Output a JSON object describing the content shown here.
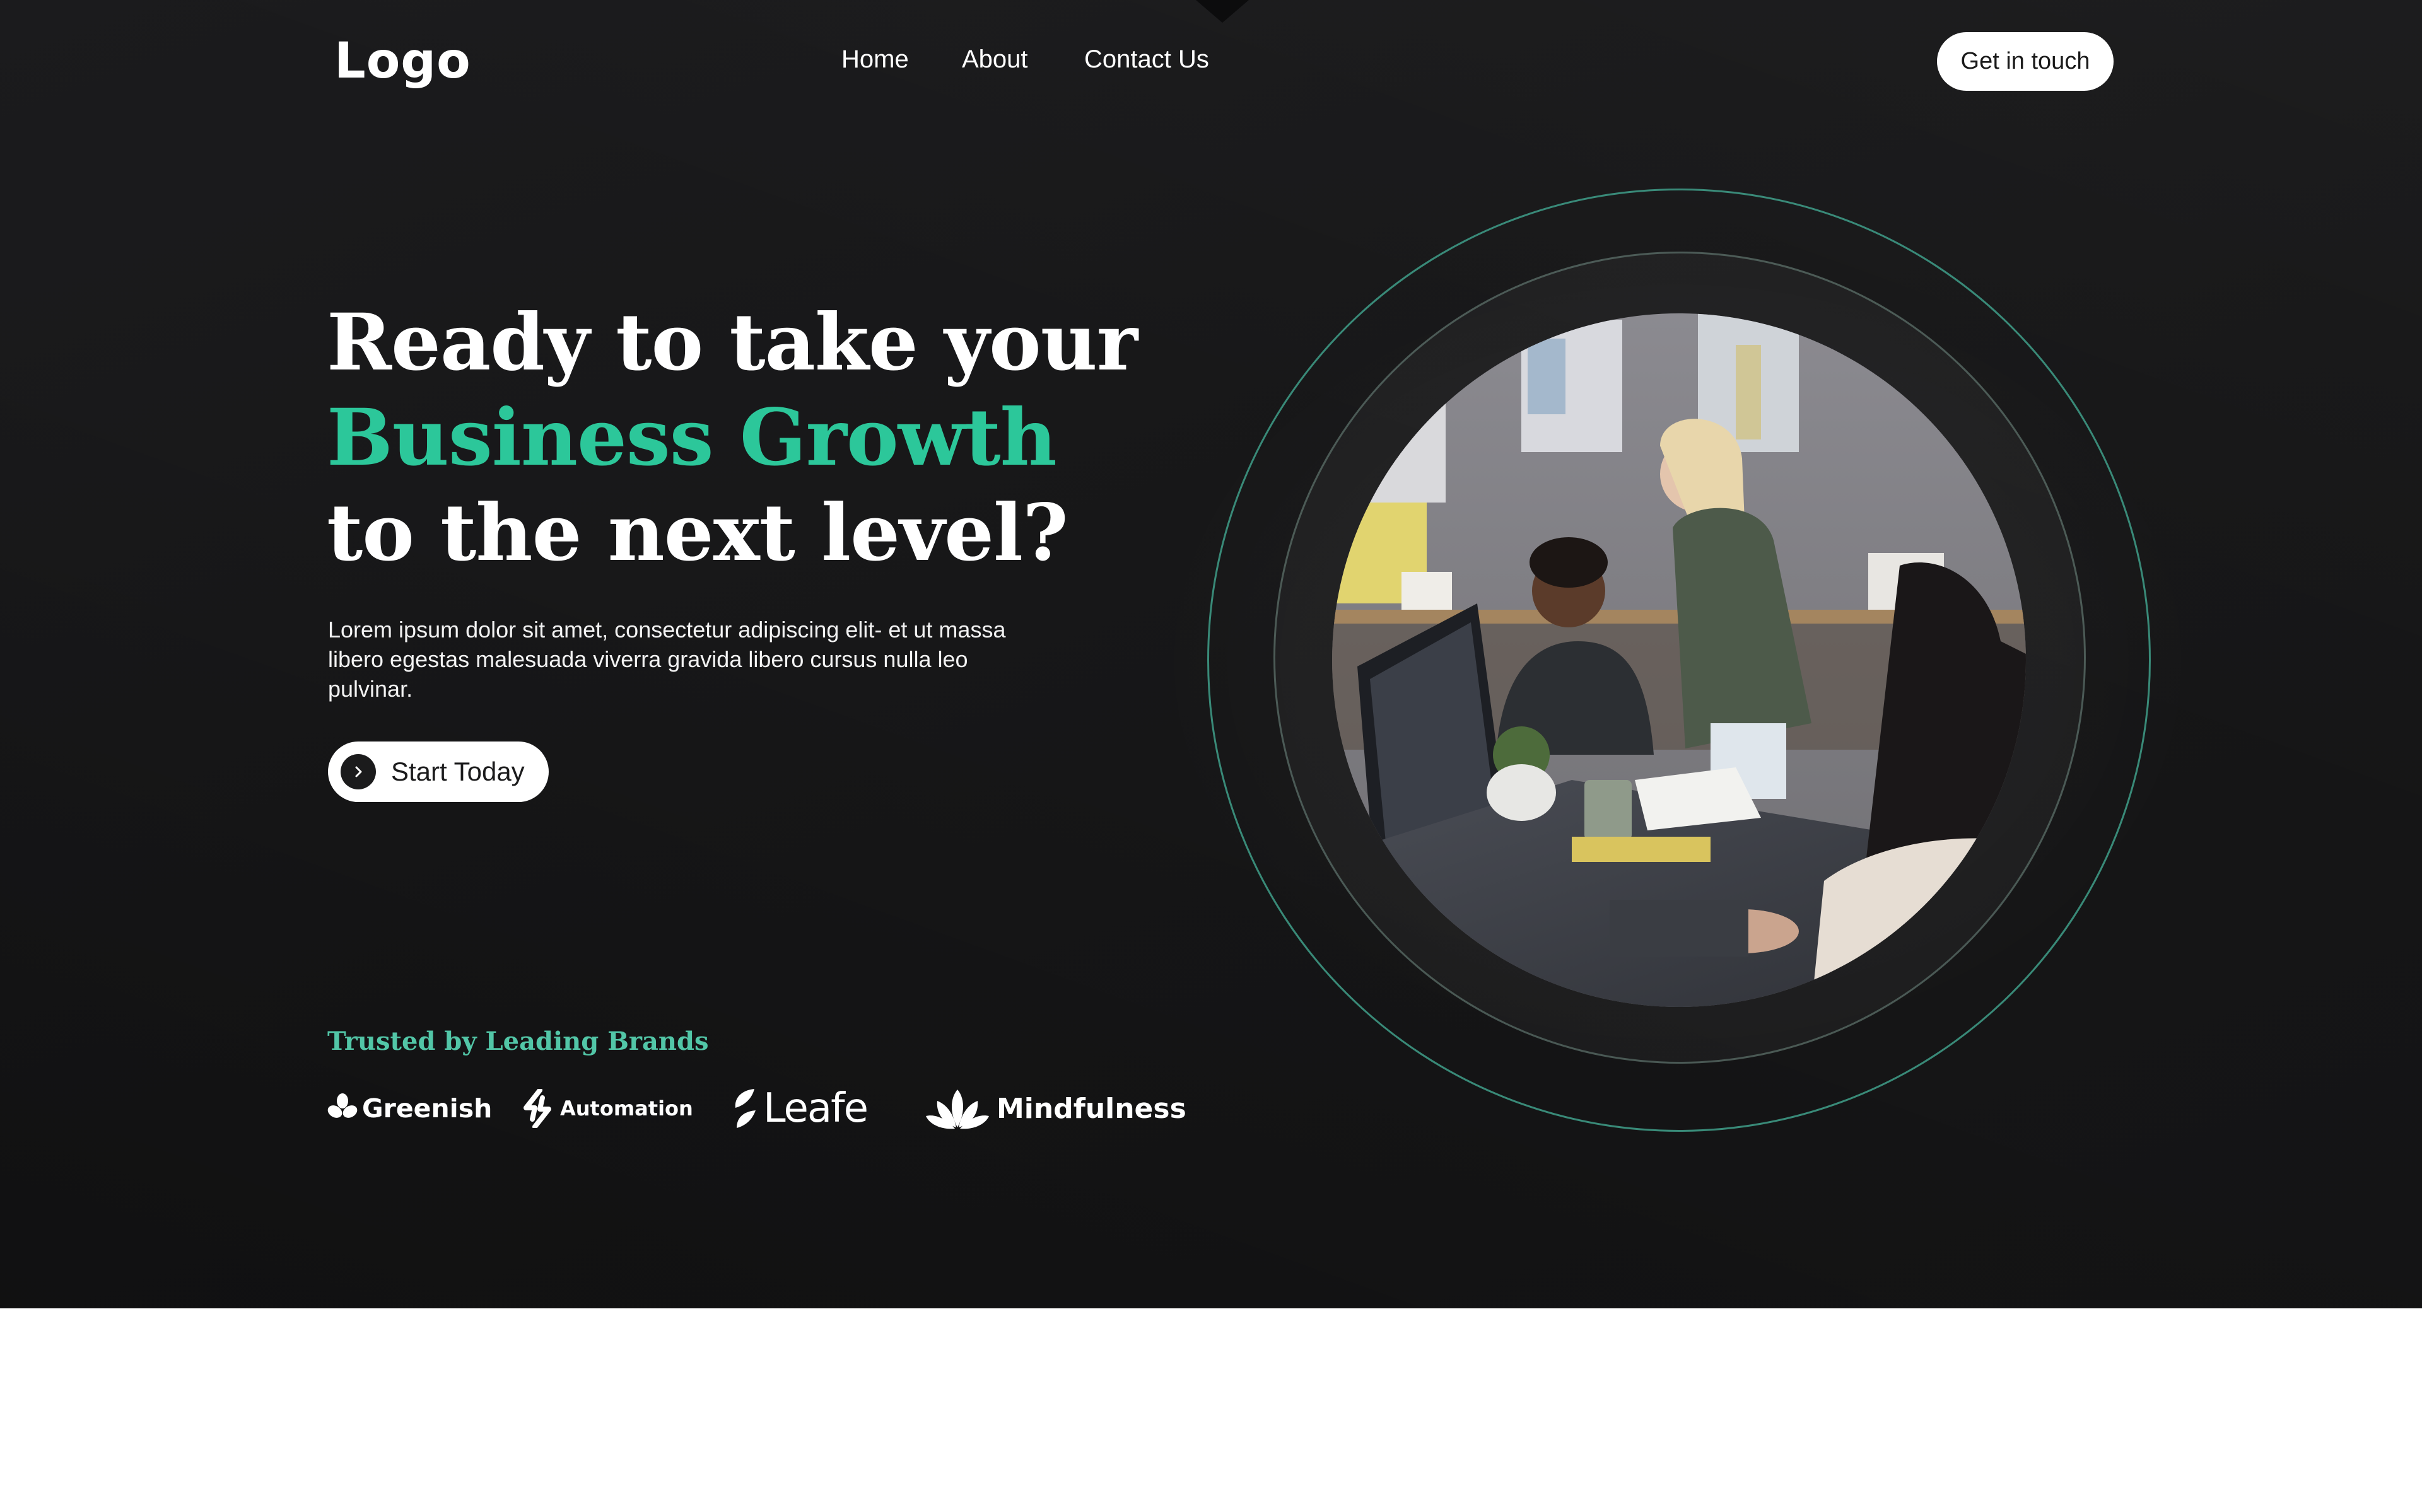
{
  "header": {
    "logo": "Logo",
    "nav": [
      {
        "label": "Home"
      },
      {
        "label": "About"
      },
      {
        "label": "Contact Us"
      }
    ],
    "cta_label": "Get in touch"
  },
  "hero": {
    "headline_line1": "Ready to take your",
    "headline_line2": "Business Growth",
    "headline_line3": "to the next level?",
    "body": "Lorem ipsum dolor sit amet, consectetur adipiscing elit- et ut massa libero egestas malesuada viverra gravida libero cursus nulla leo pulvinar.",
    "button_label": "Start Today",
    "trusted_heading": "Trusted by Leading Brands",
    "brands": [
      {
        "name": "Greenish",
        "icon": "flower-icon"
      },
      {
        "name": "Automation",
        "icon": "sync-icon"
      },
      {
        "name": "Leafe",
        "icon": "leaf-icon"
      },
      {
        "name": "Mindfulness",
        "icon": "lotus-icon"
      }
    ],
    "image_subject": "team-working-in-office-photo"
  },
  "colors": {
    "background": "#161617",
    "accent_green": "#2cc79a",
    "trusted_teal": "#52c6a7",
    "ring_teal": "#3f9f8a",
    "white": "#ffffff"
  }
}
